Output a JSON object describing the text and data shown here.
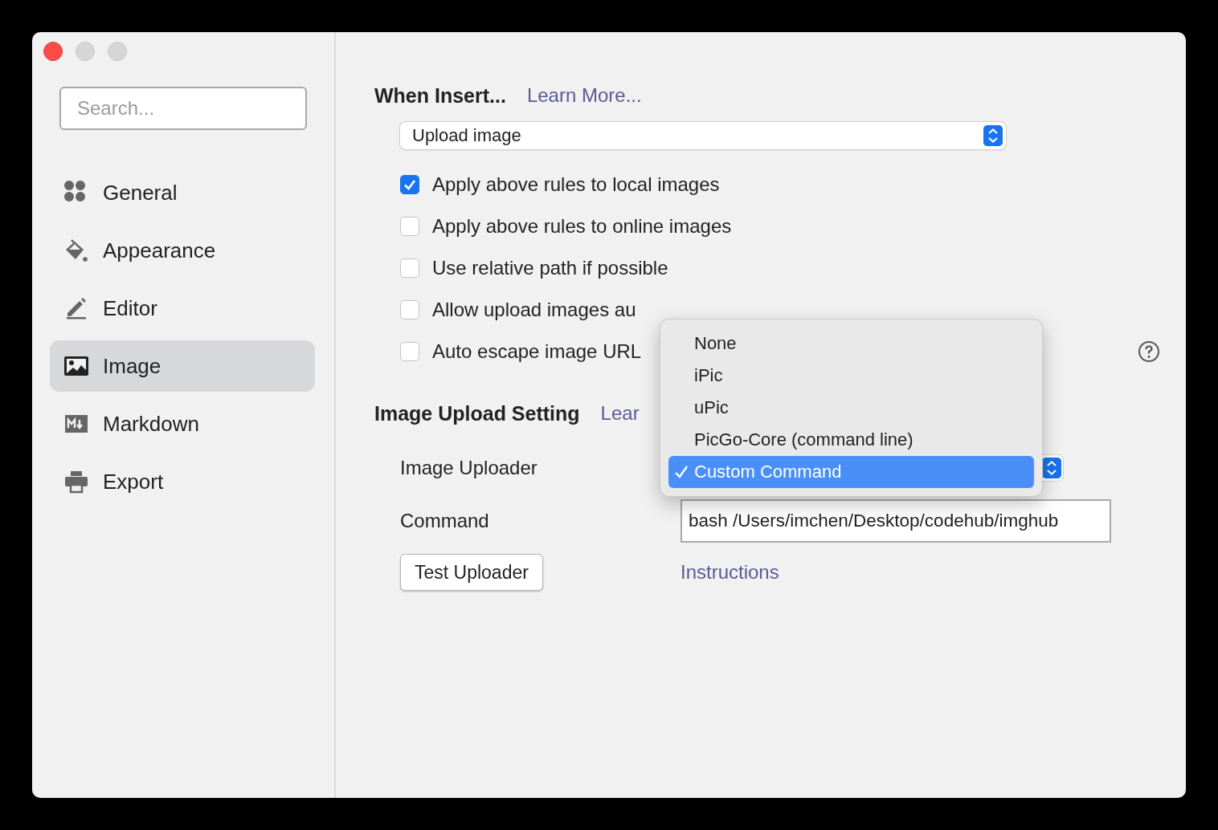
{
  "sidebar": {
    "search": {
      "placeholder": "Search..."
    },
    "items": [
      {
        "label": "General",
        "selected": false
      },
      {
        "label": "Appearance",
        "selected": false
      },
      {
        "label": "Editor",
        "selected": false
      },
      {
        "label": "Image",
        "selected": true
      },
      {
        "label": "Markdown",
        "selected": false
      },
      {
        "label": "Export",
        "selected": false
      }
    ]
  },
  "when_insert": {
    "title": "When Insert...",
    "link": "Learn More...",
    "select": {
      "value": "Upload image"
    },
    "options": [
      {
        "label": "Apply above rules to local images",
        "checked": true
      },
      {
        "label": "Apply above rules to online images",
        "checked": false
      },
      {
        "label": "Use relative path if possible",
        "checked": false
      },
      {
        "label": "Allow upload images au",
        "checked": false
      },
      {
        "label": "Auto escape image URL",
        "checked": false
      }
    ]
  },
  "upload_setting": {
    "title": "Image Upload Setting",
    "link": "Lear",
    "uploader_label": "Image Uploader",
    "command_label": "Command",
    "command_value": "bash /Users/imchen/Desktop/codehub/imghub",
    "test_button": "Test Uploader",
    "instructions_link": "Instructions"
  },
  "uploader_menu": [
    {
      "label": "None",
      "selected": false
    },
    {
      "label": "iPic",
      "selected": false
    },
    {
      "label": "uPic",
      "selected": false
    },
    {
      "label": "PicGo-Core (command line)",
      "selected": false
    },
    {
      "label": "Custom Command",
      "selected": true
    }
  ]
}
